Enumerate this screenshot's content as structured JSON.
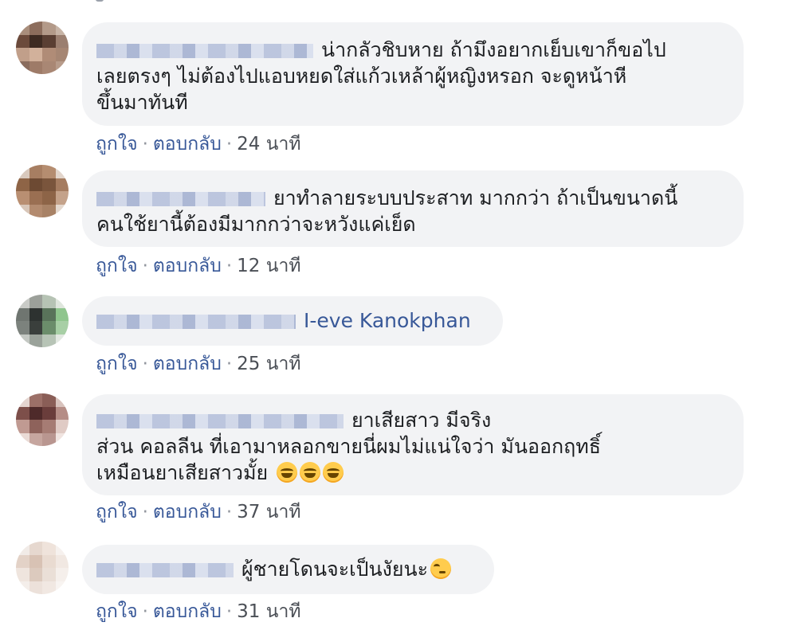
{
  "actions": {
    "like": "ถูกใจ",
    "reply": "ตอบกลับ",
    "separator": "·"
  },
  "comments": [
    {
      "lines": [
        "น่ากลัวชิบหาย ถ้ามึงอยากเย็บเขาก็ขอไป",
        "เลยตรงๆ ไม่ต้องไปแอบหยดใส่แก้วเหล้าผู้หญิงหรอก จะดูหน้าหี",
        "ขึ้นมาทันที"
      ],
      "time": "24 นาที"
    },
    {
      "lines": [
        "ยาทำลายระบบประสาท มากกว่า ถ้าเป็นขนาดนี้",
        "คนใช้ยานี้ต้องมีมากกว่าจะหวังแค่เย็ด"
      ],
      "time": "12 นาที"
    },
    {
      "tag": "I-eve Kanokphan",
      "time": "25 นาที"
    },
    {
      "lines": [
        "ยาเสียสาว มีจริง",
        "ส่วน คอลลีน ที่เอามาหลอกขายนี่ผมไม่แน่ใจว่า มันออกฤทธิ์",
        "เหมือนยาเสียสาวมั้ย"
      ],
      "emojis": [
        "grinning-sweat-emoji",
        "grinning-sweat-emoji",
        "grinning-sweat-emoji"
      ],
      "time": "37 นาที"
    },
    {
      "lines": [
        "ผู้ชายโดนจะเป็นงัยนะ"
      ],
      "emojis": [
        "thinking-face-emoji"
      ],
      "time": "31 นาที"
    }
  ]
}
